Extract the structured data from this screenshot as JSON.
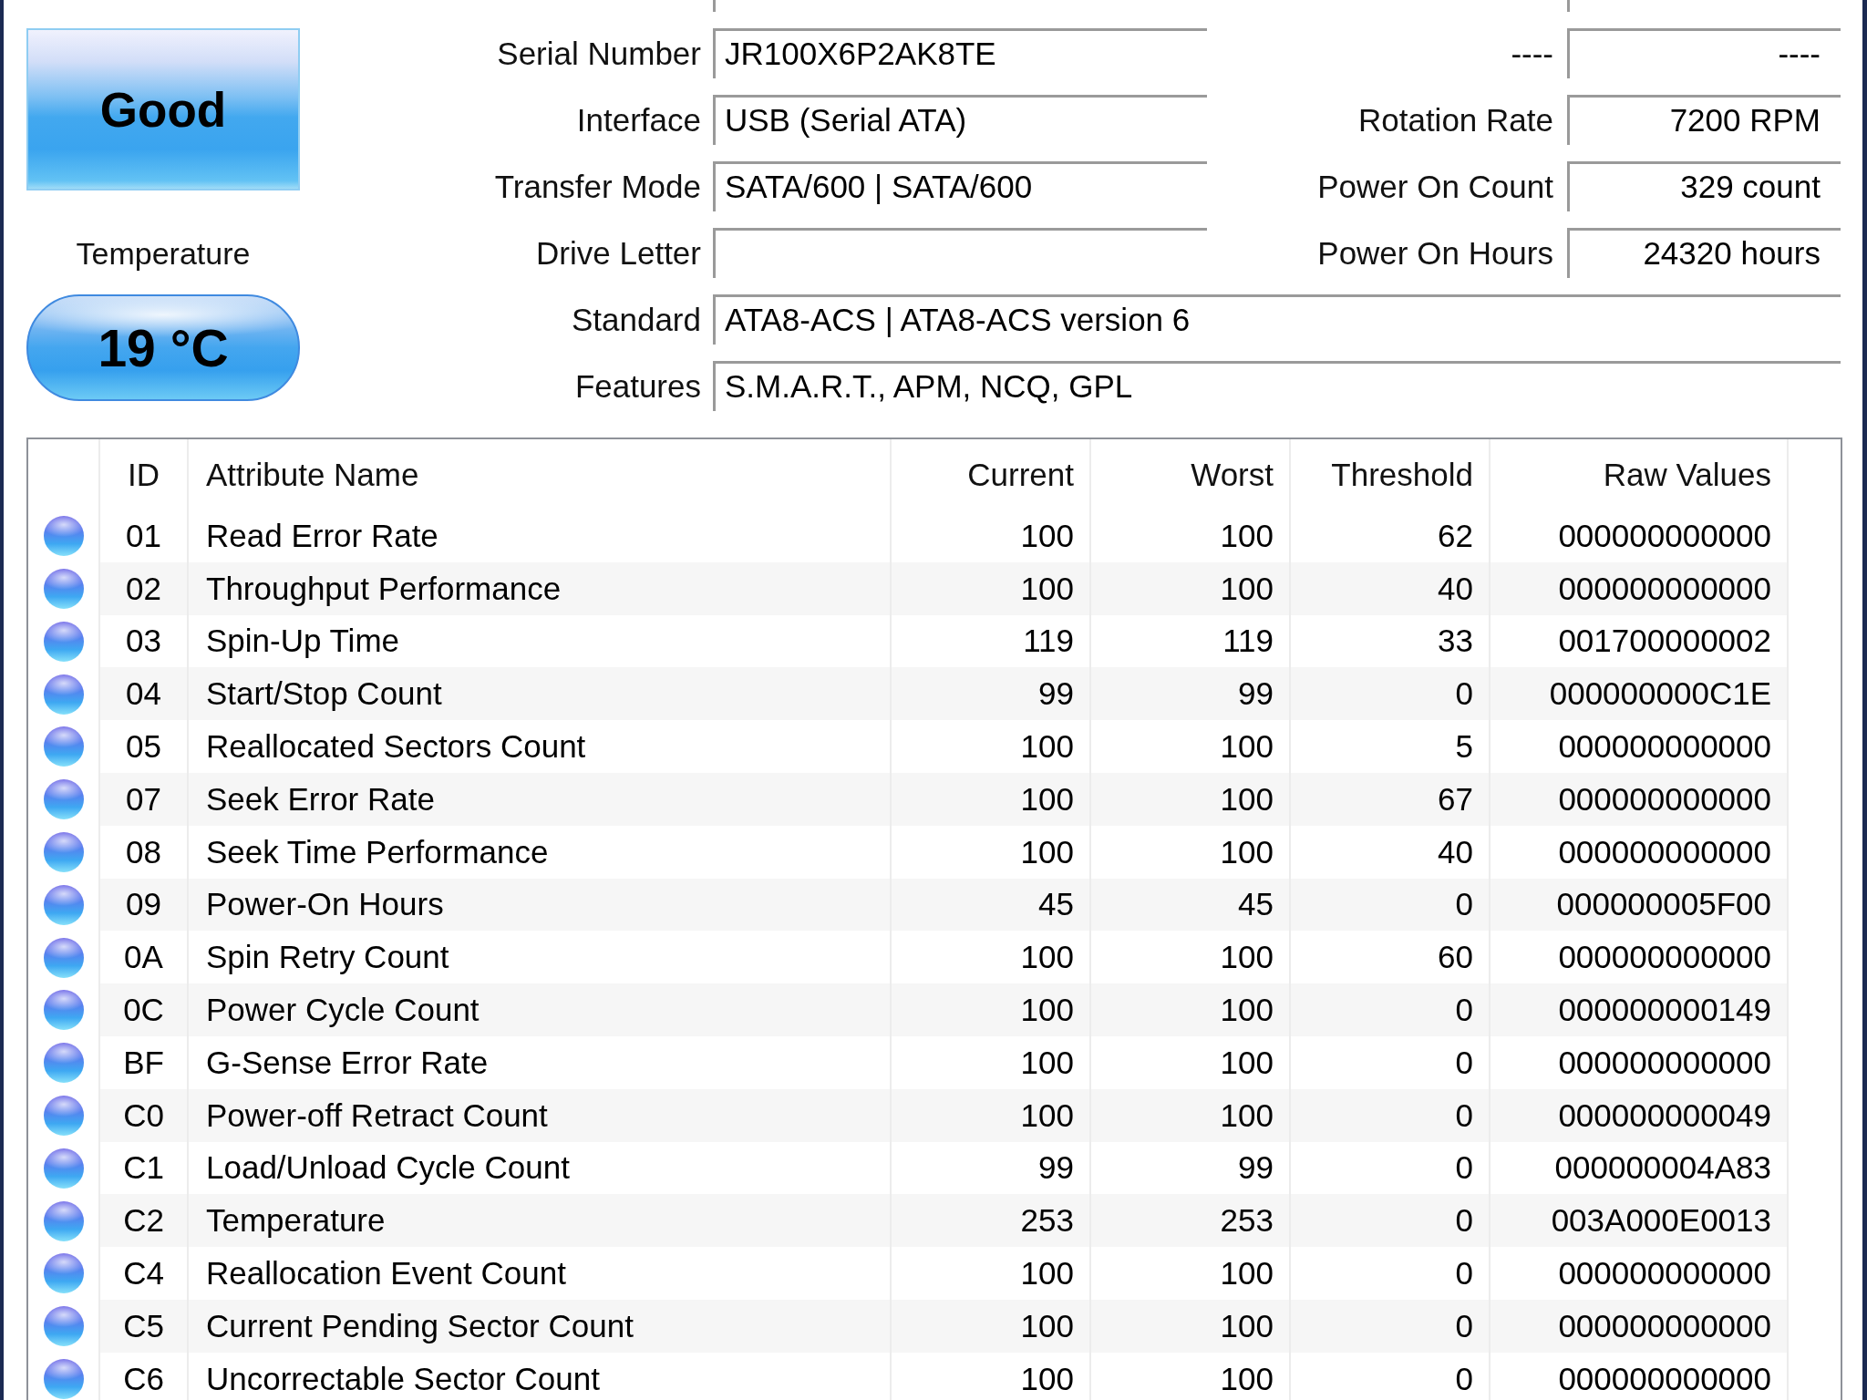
{
  "health": {
    "label": "Good"
  },
  "temperature": {
    "label": "Temperature",
    "value": "19 °C"
  },
  "info_rows": [
    {
      "kind": "split",
      "left": {
        "label": "Serial Number",
        "value": "JR100X6P2AK8TE"
      },
      "right": {
        "label": "----",
        "value": "----"
      }
    },
    {
      "kind": "split",
      "left": {
        "label": "Interface",
        "value": "USB (Serial ATA)"
      },
      "right": {
        "label": "Rotation Rate",
        "value": "7200 RPM"
      }
    },
    {
      "kind": "split",
      "left": {
        "label": "Transfer Mode",
        "value": "SATA/600 | SATA/600"
      },
      "right": {
        "label": "Power On Count",
        "value": "329 count"
      }
    },
    {
      "kind": "split",
      "left": {
        "label": "Drive Letter"
      },
      "right": {
        "label": "Power On Hours",
        "value": "24320 hours"
      }
    },
    {
      "kind": "wide",
      "label": "Standard",
      "value": "ATA8-ACS | ATA8-ACS version 6"
    },
    {
      "kind": "wide",
      "label": "Features",
      "value": "S.M.A.R.T., APM, NCQ, GPL"
    }
  ],
  "smart_table": {
    "columns": [
      "ID",
      "Attribute Name",
      "Current",
      "Worst",
      "Threshold",
      "Raw Values"
    ],
    "rows": [
      {
        "id": "01",
        "name": "Read Error Rate",
        "current": "100",
        "worst": "100",
        "threshold": "62",
        "raw_values": "000000000000"
      },
      {
        "id": "02",
        "name": "Throughput Performance",
        "current": "100",
        "worst": "100",
        "threshold": "40",
        "raw_values": "000000000000"
      },
      {
        "id": "03",
        "name": "Spin-Up Time",
        "current": "119",
        "worst": "119",
        "threshold": "33",
        "raw_values": "001700000002"
      },
      {
        "id": "04",
        "name": "Start/Stop Count",
        "current": "99",
        "worst": "99",
        "threshold": "0",
        "raw_values": "000000000C1E"
      },
      {
        "id": "05",
        "name": "Reallocated Sectors Count",
        "current": "100",
        "worst": "100",
        "threshold": "5",
        "raw_values": "000000000000"
      },
      {
        "id": "07",
        "name": "Seek Error Rate",
        "current": "100",
        "worst": "100",
        "threshold": "67",
        "raw_values": "000000000000"
      },
      {
        "id": "08",
        "name": "Seek Time Performance",
        "current": "100",
        "worst": "100",
        "threshold": "40",
        "raw_values": "000000000000"
      },
      {
        "id": "09",
        "name": "Power-On Hours",
        "current": "45",
        "worst": "45",
        "threshold": "0",
        "raw_values": "000000005F00"
      },
      {
        "id": "0A",
        "name": "Spin Retry Count",
        "current": "100",
        "worst": "100",
        "threshold": "60",
        "raw_values": "000000000000"
      },
      {
        "id": "0C",
        "name": "Power Cycle Count",
        "current": "100",
        "worst": "100",
        "threshold": "0",
        "raw_values": "000000000149"
      },
      {
        "id": "BF",
        "name": "G-Sense Error Rate",
        "current": "100",
        "worst": "100",
        "threshold": "0",
        "raw_values": "000000000000"
      },
      {
        "id": "C0",
        "name": "Power-off Retract Count",
        "current": "100",
        "worst": "100",
        "threshold": "0",
        "raw_values": "000000000049"
      },
      {
        "id": "C1",
        "name": "Load/Unload Cycle Count",
        "current": "99",
        "worst": "99",
        "threshold": "0",
        "raw_values": "000000004A83"
      },
      {
        "id": "C2",
        "name": "Temperature",
        "current": "253",
        "worst": "253",
        "threshold": "0",
        "raw_values": "003A000E0013"
      },
      {
        "id": "C4",
        "name": "Reallocation Event Count",
        "current": "100",
        "worst": "100",
        "threshold": "0",
        "raw_values": "000000000000"
      },
      {
        "id": "C5",
        "name": "Current Pending Sector Count",
        "current": "100",
        "worst": "100",
        "threshold": "0",
        "raw_values": "000000000000"
      },
      {
        "id": "C6",
        "name": "Uncorrectable Sector Count",
        "current": "100",
        "worst": "100",
        "threshold": "0",
        "raw_values": "000000000000"
      }
    ]
  }
}
